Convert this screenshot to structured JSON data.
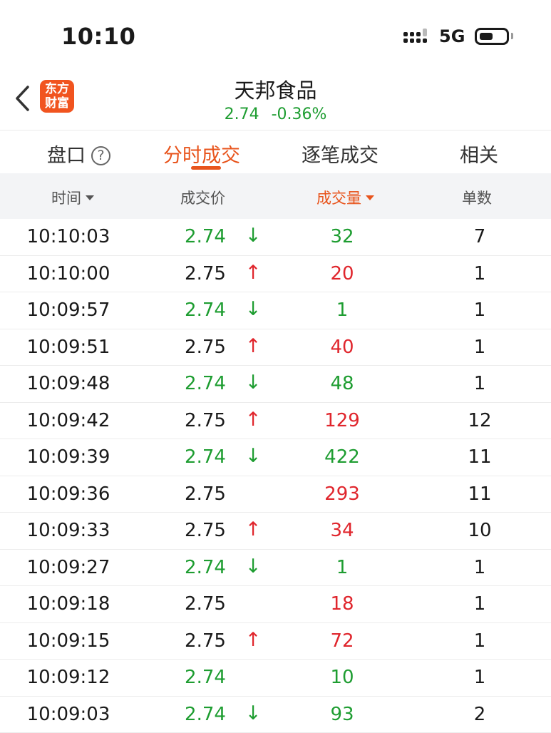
{
  "status_bar": {
    "time": "10:10",
    "network": "5G"
  },
  "nav": {
    "logo_line1": "东方",
    "logo_line2": "财富",
    "stock_name": "天邦食品",
    "price": "2.74",
    "change_pct": "-0.36%"
  },
  "tabs": [
    {
      "label": "盘口",
      "active": false
    },
    {
      "label": "分时成交",
      "active": true
    },
    {
      "label": "逐笔成交",
      "active": false
    },
    {
      "label": "相关",
      "active": false
    }
  ],
  "help_glyph": "?",
  "columns": {
    "time": "时间",
    "price": "成交价",
    "volume": "成交量",
    "count": "单数"
  },
  "colors": {
    "up": "#e0262d",
    "down": "#1e9d31",
    "accent": "#e8541c"
  },
  "trades": [
    {
      "time": "10:10:03",
      "price": "2.74",
      "direction": "down",
      "volume": "32",
      "count": "7"
    },
    {
      "time": "10:10:00",
      "price": "2.75",
      "direction": "up",
      "volume": "20",
      "count": "1"
    },
    {
      "time": "10:09:57",
      "price": "2.74",
      "direction": "down",
      "volume": "1",
      "count": "1"
    },
    {
      "time": "10:09:51",
      "price": "2.75",
      "direction": "up",
      "volume": "40",
      "count": "1"
    },
    {
      "time": "10:09:48",
      "price": "2.74",
      "direction": "down",
      "volume": "48",
      "count": "1"
    },
    {
      "time": "10:09:42",
      "price": "2.75",
      "direction": "up",
      "volume": "129",
      "count": "12"
    },
    {
      "time": "10:09:39",
      "price": "2.74",
      "direction": "down",
      "volume": "422",
      "count": "11"
    },
    {
      "time": "10:09:36",
      "price": "2.75",
      "direction": "none",
      "volume": "293",
      "count": "11"
    },
    {
      "time": "10:09:33",
      "price": "2.75",
      "direction": "up",
      "volume": "34",
      "count": "10"
    },
    {
      "time": "10:09:27",
      "price": "2.74",
      "direction": "down",
      "volume": "1",
      "count": "1"
    },
    {
      "time": "10:09:18",
      "price": "2.75",
      "direction": "none",
      "volume": "18",
      "count": "1"
    },
    {
      "time": "10:09:15",
      "price": "2.75",
      "direction": "up",
      "volume": "72",
      "count": "1"
    },
    {
      "time": "10:09:12",
      "price": "2.74",
      "direction": "none",
      "volume": "10",
      "count": "1"
    },
    {
      "time": "10:09:03",
      "price": "2.74",
      "direction": "down",
      "volume": "93",
      "count": "2"
    }
  ]
}
